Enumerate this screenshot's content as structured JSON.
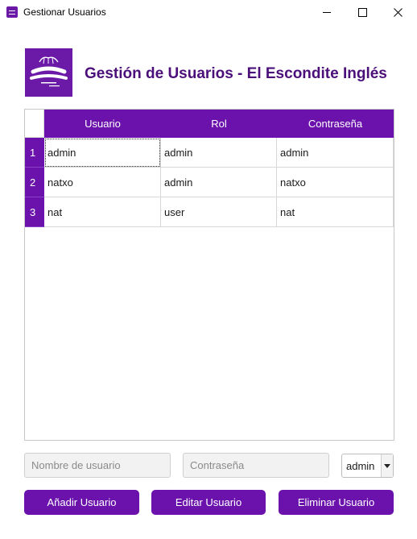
{
  "window": {
    "title": "Gestionar Usuarios"
  },
  "header": {
    "logo_text": "El Escondite Inglés",
    "title": "Gestión de Usuarios - El Escondite Inglés"
  },
  "table": {
    "columns": [
      "Usuario",
      "Rol",
      "Contraseña"
    ],
    "rows": [
      {
        "num": "1",
        "usuario": "admin",
        "rol": "admin",
        "contrasena": "admin"
      },
      {
        "num": "2",
        "usuario": "natxo",
        "rol": "admin",
        "contrasena": "natxo"
      },
      {
        "num": "3",
        "usuario": "nat",
        "rol": "user",
        "contrasena": "nat"
      }
    ]
  },
  "form": {
    "username_placeholder": "Nombre de usuario",
    "username_value": "",
    "password_placeholder": "Contraseña",
    "password_value": "",
    "role_selected": "admin"
  },
  "buttons": {
    "add": "Añadir Usuario",
    "edit": "Editar Usuario",
    "delete": "Eliminar Usuario"
  },
  "colors": {
    "accent": "#6b12ad",
    "heading": "#4b0f7a"
  },
  "icons": {
    "app": "app-logo-icon",
    "minimize": "minimize-icon",
    "maximize": "maximize-icon",
    "close": "close-icon",
    "dropdown": "dropdown-arrow-icon"
  }
}
